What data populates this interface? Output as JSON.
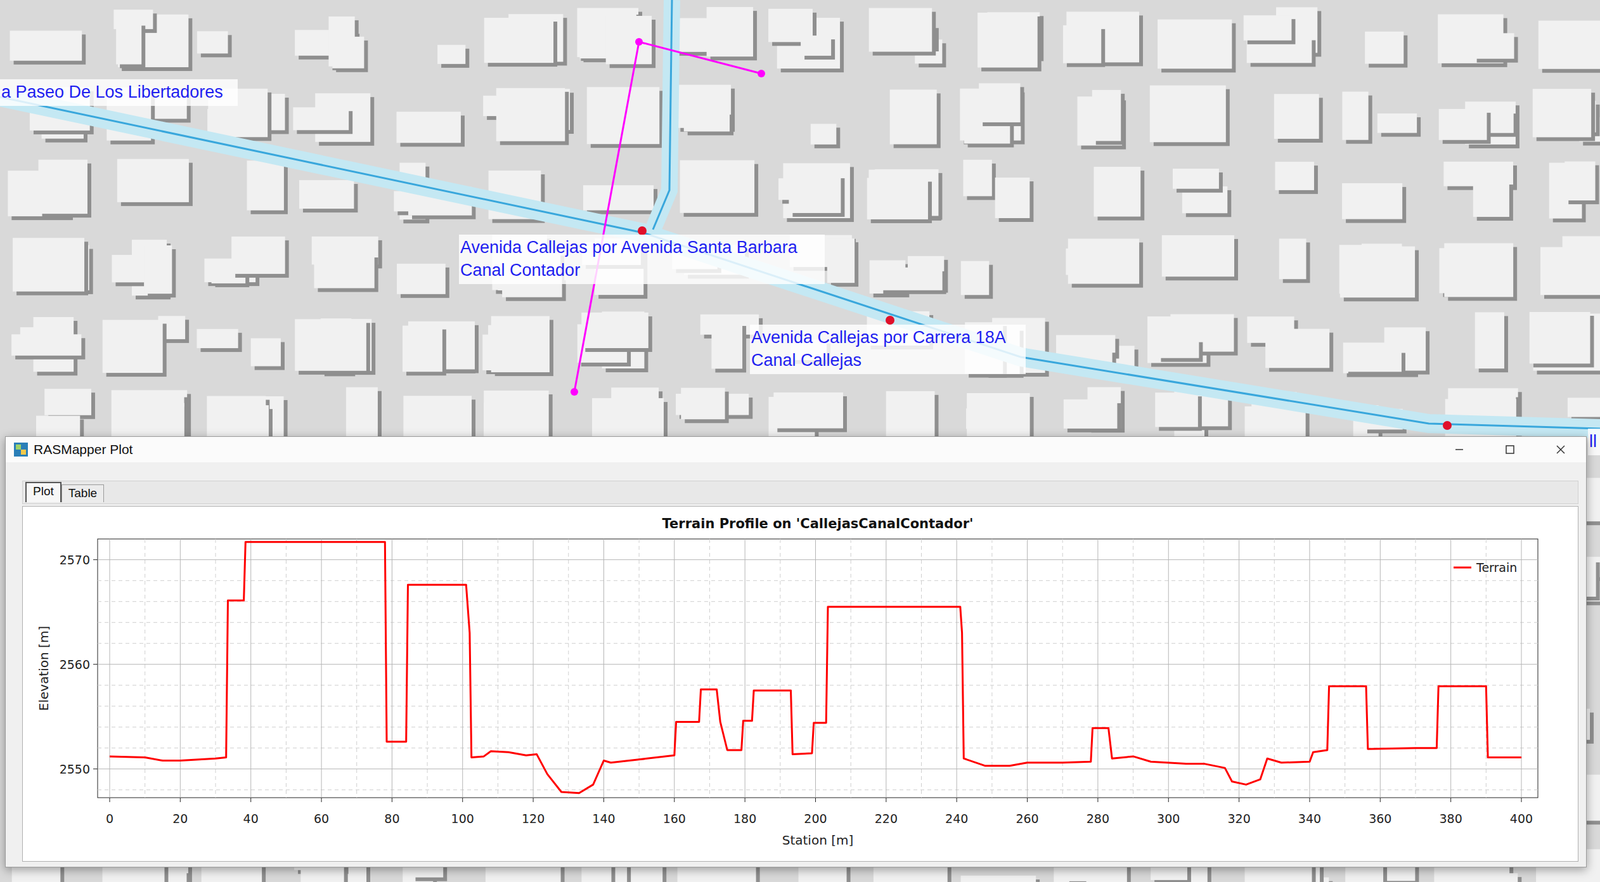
{
  "map": {
    "labels": [
      {
        "lines": [
          "a Paseo De Los Libertadores"
        ]
      },
      {
        "lines": [
          "Avenida Callejas por Avenida Santa Barbara",
          "Canal Contador"
        ]
      },
      {
        "lines": [
          "Avenida Callejas por Carrera 18A",
          "Canal Callejas"
        ]
      },
      {
        "lines": [
          "ll"
        ]
      }
    ]
  },
  "window": {
    "title": "RASMapper Plot"
  },
  "tabs": [
    {
      "label": "Plot",
      "selected": true
    },
    {
      "label": "Table",
      "selected": false
    }
  ],
  "chart": {
    "title": "Terrain Profile on 'CallejasCanalContador'",
    "x_axis": {
      "label": "Station [m]",
      "ticks": [
        "0",
        "20",
        "40",
        "60",
        "80",
        "100",
        "120",
        "140",
        "160",
        "180",
        "200",
        "220",
        "240",
        "260",
        "280",
        "300",
        "320",
        "340",
        "360",
        "380",
        "400"
      ]
    },
    "y_axis": {
      "label": "Elevation [m]",
      "ticks": [
        "2550",
        "2560",
        "2570"
      ]
    },
    "series": [
      {
        "name": "Terrain",
        "station": [
          0,
          10,
          15,
          20,
          30,
          33,
          33.5,
          38,
          38.5,
          78,
          78.5,
          84,
          84.5,
          101,
          102,
          102.5,
          106,
          108,
          113,
          118,
          121,
          124,
          128,
          133,
          137,
          140,
          142,
          150,
          160,
          160.5,
          167,
          167.5,
          172,
          173,
          175,
          179,
          179.5,
          182,
          182.5,
          193,
          193.5,
          199,
          199.5,
          203,
          203.5,
          241,
          241.5,
          242,
          248,
          255,
          260,
          270,
          278,
          278.5,
          283,
          284,
          290,
          295,
          305,
          310,
          316,
          318,
          322,
          326,
          328,
          332,
          340,
          341,
          345,
          345.5,
          356,
          356.5,
          370,
          376,
          376.5,
          390,
          390.5,
          400
        ],
        "elevation": [
          2551.2,
          2551.1,
          2550.8,
          2550.8,
          2551.0,
          2551.1,
          2566.1,
          2566.1,
          2571.7,
          2571.7,
          2552.6,
          2552.6,
          2567.6,
          2567.6,
          2563.0,
          2551.1,
          2551.2,
          2551.7,
          2551.6,
          2551.3,
          2551.4,
          2549.5,
          2547.8,
          2547.7,
          2548.5,
          2550.8,
          2550.6,
          2550.9,
          2551.3,
          2554.5,
          2554.5,
          2557.6,
          2557.6,
          2554.5,
          2551.8,
          2551.8,
          2554.6,
          2554.6,
          2557.5,
          2557.5,
          2551.4,
          2551.5,
          2554.4,
          2554.4,
          2565.5,
          2565.5,
          2563.0,
          2551.0,
          2550.3,
          2550.3,
          2550.6,
          2550.6,
          2550.7,
          2553.9,
          2553.9,
          2551.0,
          2551.2,
          2550.7,
          2550.5,
          2550.5,
          2550.1,
          2548.8,
          2548.5,
          2549.0,
          2551.0,
          2550.6,
          2550.7,
          2551.6,
          2551.8,
          2557.9,
          2557.9,
          2551.9,
          2552.0,
          2552.0,
          2557.9,
          2557.9,
          2551.1,
          2551.1
        ]
      }
    ]
  }
}
